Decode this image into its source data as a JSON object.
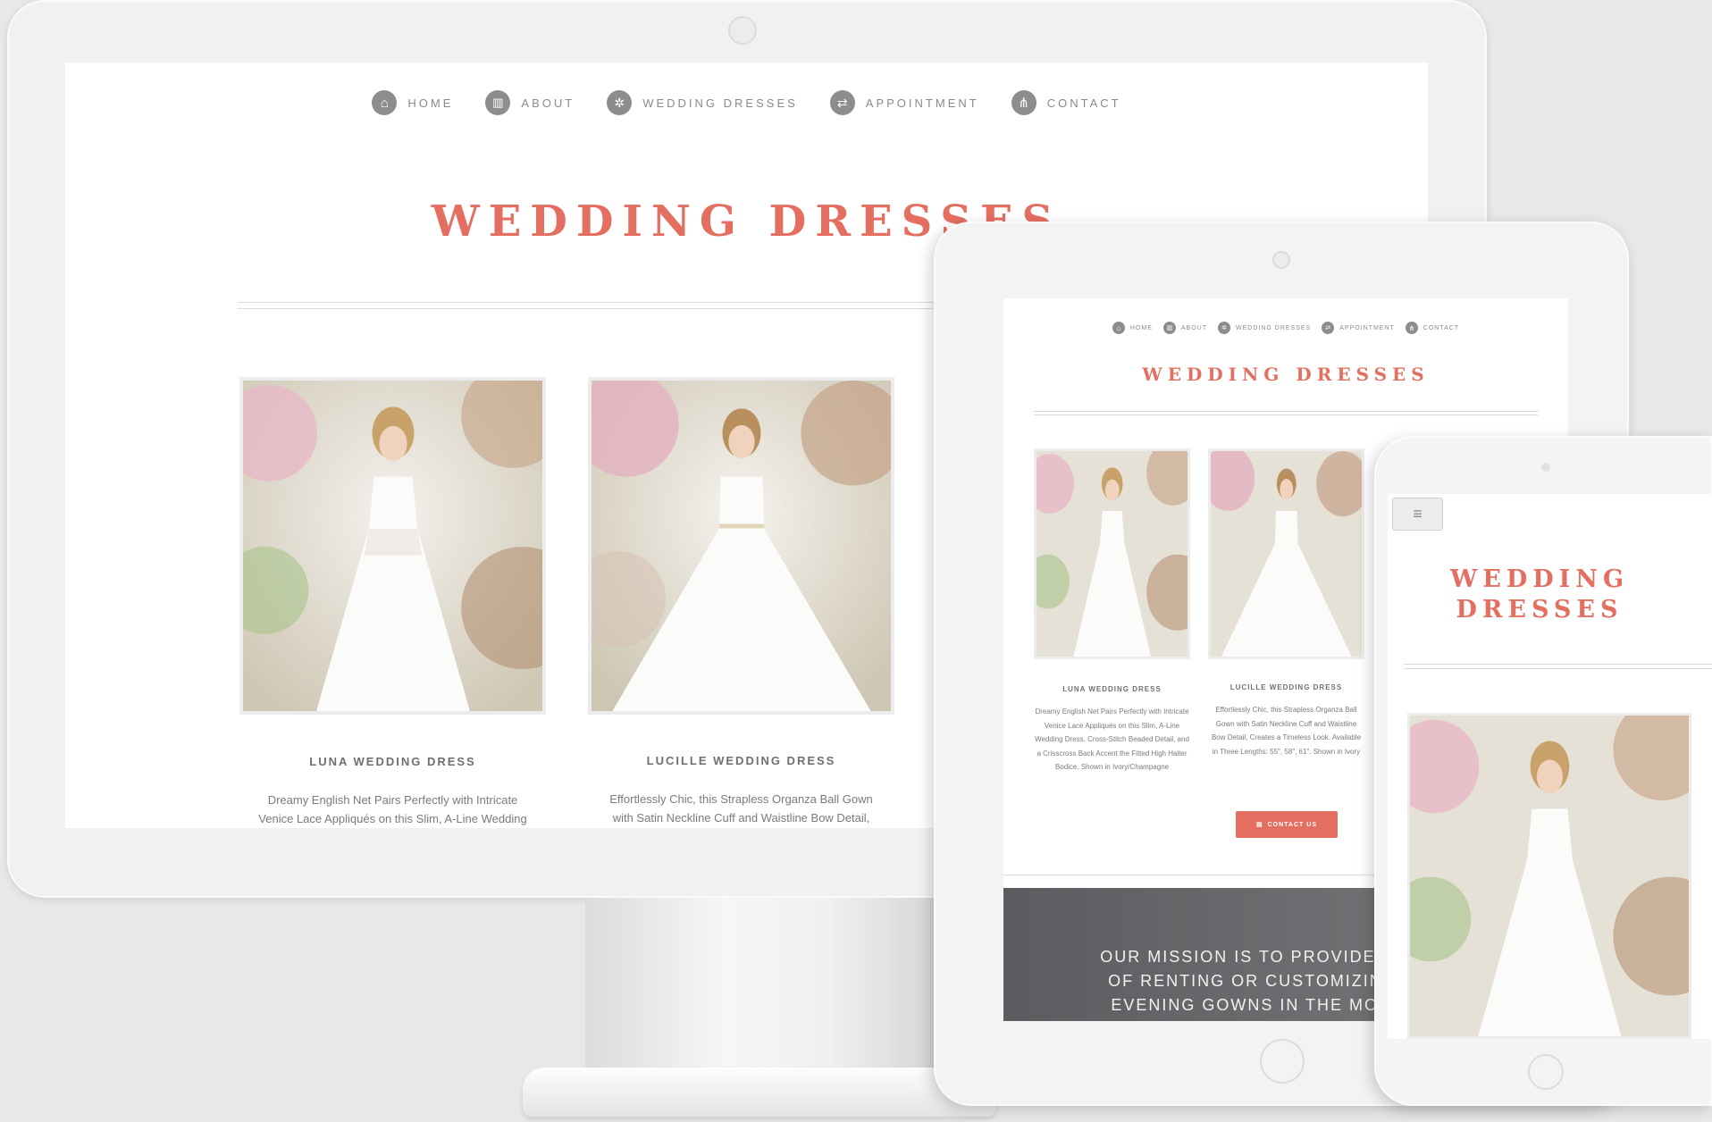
{
  "nav": {
    "items": [
      {
        "label": "HOME",
        "icon": "home-icon",
        "glyph": "⌂"
      },
      {
        "label": "ABOUT",
        "icon": "chart-icon",
        "glyph": "▥"
      },
      {
        "label": "WEDDING DRESSES",
        "icon": "gear-icon",
        "glyph": "✲"
      },
      {
        "label": "APPOINTMENT",
        "icon": "repeat-icon",
        "glyph": "⇄"
      },
      {
        "label": "CONTACT",
        "icon": "sitemap-icon",
        "glyph": "⋔"
      }
    ]
  },
  "page": {
    "title": "WEDDING DRESSES",
    "phone_title_line1": "WEDDING",
    "phone_title_line2": "DRESSES"
  },
  "products": [
    {
      "name": "LUNA WEDDING DRESS",
      "desc_desktop_1": "Dreamy English Net Pairs Perfectly with Intricate",
      "desc_desktop_2": "Venice Lace Appliqués on this Slim, A-Line Wedding",
      "desc_tablet": "Dreamy English Net Pairs Perfectly with Intricate Venice Lace Appliqués on this Slim, A-Line Wedding Dress. Cross-Stitch Beaded Detail, and a Crisscross Back Accent the Fitted High Halter Bodice. Shown in Ivory/Champagne"
    },
    {
      "name": "LUCILLE WEDDING DRESS",
      "desc_desktop_1": "Effortlessly Chic, this Strapless Organza Ball Gown",
      "desc_desktop_2": "with Satin Neckline Cuff and Waistline Bow Detail,",
      "desc_tablet": "Effortlessly Chic, this Strapless Organza Ball Gown with Satin Neckline Cuff and Waistline Bow Detail, Creates a Timeless Look. Available in Three Lengths: 55\", 58\", 61\". Shown in Ivory"
    }
  ],
  "cta": {
    "label": "CONTACT US",
    "icon": "document-icon",
    "glyph": "▤"
  },
  "mission": {
    "line1": "OUR MISSION IS TO PROVIDE BRIDES-T",
    "line2": "OF RENTING OR CUSTOMIZING FABUL",
    "line3": "EVENING GOWNS IN THE MOST COST"
  },
  "colors": {
    "accent": "#e46f61",
    "nav_icon": "#8d8d8d",
    "mission_bg": "#5b5c5f"
  }
}
